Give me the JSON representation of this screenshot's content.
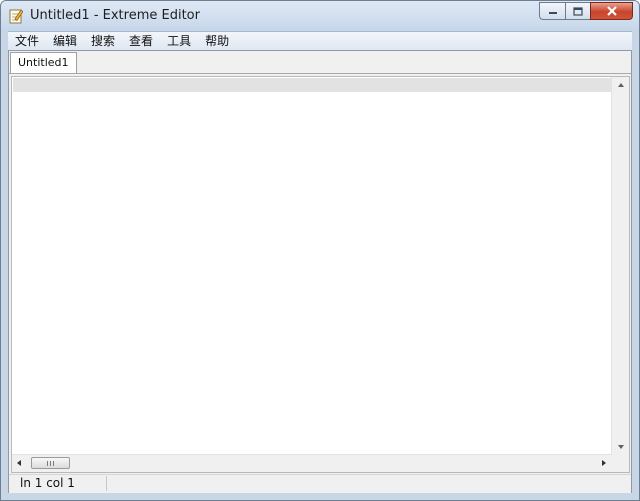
{
  "window": {
    "title": "Untitled1 - Extreme Editor",
    "icon": "notepad-pencil-icon"
  },
  "caption_buttons": {
    "minimize_icon": "minimize-icon",
    "maximize_icon": "maximize-icon",
    "close_icon": "close-icon"
  },
  "menu": {
    "items": [
      {
        "label": "文件"
      },
      {
        "label": "编辑"
      },
      {
        "label": "搜索"
      },
      {
        "label": "查看"
      },
      {
        "label": "工具"
      },
      {
        "label": "帮助"
      }
    ]
  },
  "tabs": [
    {
      "label": "Untitled1",
      "active": true
    }
  ],
  "editor": {
    "content": ""
  },
  "statusbar": {
    "position": "ln 1 col 1"
  },
  "colors": {
    "title_bar": "#c6d6ea",
    "close_button": "#c8452c",
    "current_line_highlight": "#e2e2e2"
  }
}
